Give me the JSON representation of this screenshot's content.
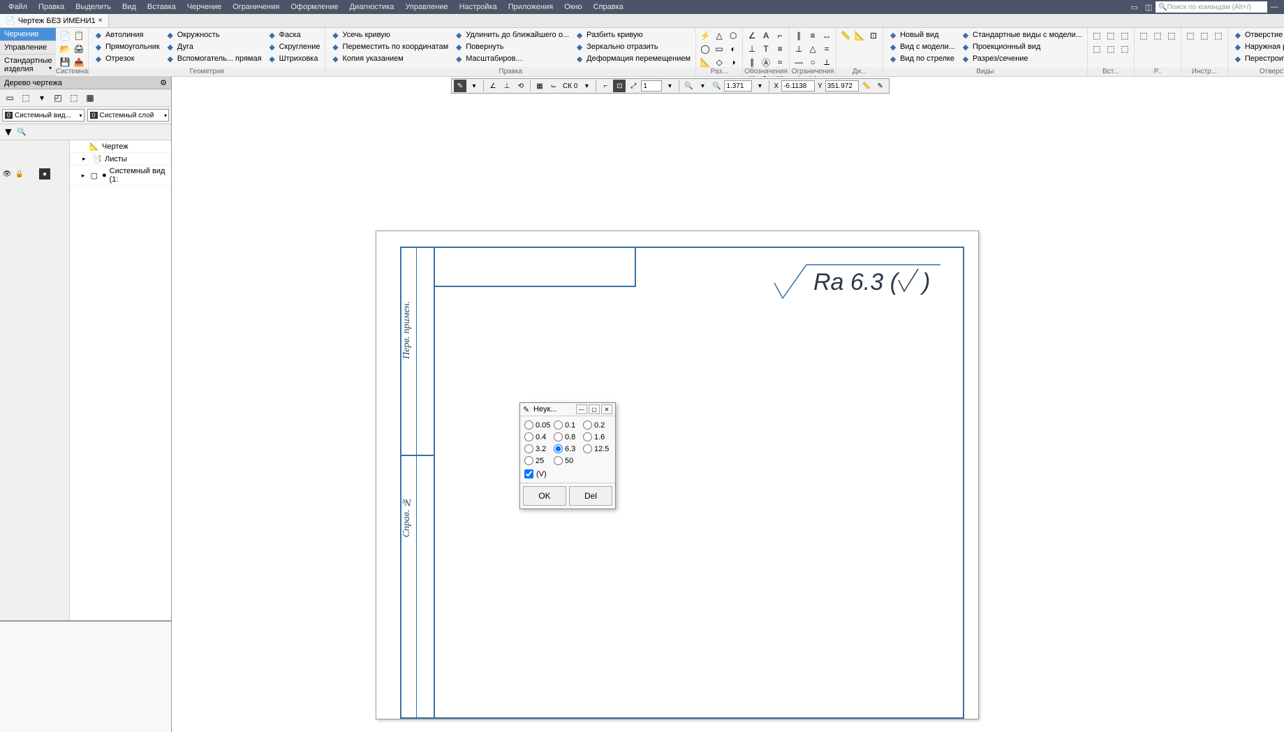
{
  "menubar": {
    "items": [
      "Файл",
      "Правка",
      "Выделить",
      "Вид",
      "Вставка",
      "Черчение",
      "Ограничения",
      "Оформление",
      "Диагностика",
      "Управление",
      "Настройка",
      "Приложения",
      "Окно",
      "Справка"
    ],
    "search_placeholder": "Поиск по командам (Alt+/)"
  },
  "doc_tab": {
    "title": "Чертеж БЕЗ ИМЕНИ1"
  },
  "ribbon_tabs": {
    "active": "Черчение",
    "others": [
      "Управление",
      "Стандартные изделия"
    ]
  },
  "ribbon": {
    "groups": [
      {
        "label": "Системная",
        "type": "icons"
      },
      {
        "label": "Геометрия",
        "cols": [
          [
            "Автолиния",
            "Прямоугольник",
            "Отрезок"
          ],
          [
            "Окружность",
            "Дуга",
            "Вспомогатель... прямая"
          ],
          [
            "Фаска",
            "Скругление",
            "Штриховка"
          ]
        ]
      },
      {
        "label": "Правка",
        "cols": [
          [
            "Усечь кривую",
            "Переместить по координатам",
            "Копия указанием"
          ],
          [
            "Удлинить до ближайшего о...",
            "Повернуть",
            "Масштабиров..."
          ],
          [
            "Разбить кривую",
            "Зеркально отразить",
            "Деформация перемещением"
          ]
        ]
      },
      {
        "label": "Раз...",
        "type": "icon-grid"
      },
      {
        "label": "Обозначения",
        "type": "icon-grid"
      },
      {
        "label": "Ограничения",
        "type": "icon-grid"
      },
      {
        "label": "Ди...",
        "type": "icon-grid"
      },
      {
        "label": "Виды",
        "cols": [
          [
            "Новый вид",
            "Вид с модели...",
            "Вид по стрелке"
          ],
          [
            "Стандартные виды с модели...",
            "Проекционный вид",
            "Разрез/сечение"
          ]
        ]
      },
      {
        "label": "Вст...",
        "type": "icon-grid"
      },
      {
        "label": "Р..",
        "type": "icon-grid"
      },
      {
        "label": "Инстр...",
        "type": "icon-grid"
      },
      {
        "label": "Отверстия и резьбы",
        "cols": [
          [
            "Отверстие простое",
            "Наружная резьба",
            "Перестроить отверстия и из..."
          ]
        ]
      }
    ]
  },
  "tree_panel": {
    "title": "Дерево чертежа",
    "dd1": "Системный вид...",
    "dd2": "Системный слой",
    "nodes": {
      "root": "Чертеж",
      "sheets": "Листы",
      "sysview": "Системный вид (1:"
    }
  },
  "canvas_toolbar": {
    "cs": "СК 0",
    "step": "1",
    "zoom": "1.371",
    "x_label": "X",
    "x": "-6.1138",
    "y_label": "Y",
    "y": "351.972"
  },
  "roughness_text": "Ra 6.3 ( √ )",
  "sheet_labels": {
    "perv": "Перв. примен.",
    "sprav": "Справ. №"
  },
  "dialog": {
    "title": "Неук...",
    "options": [
      "0.05",
      "0.1",
      "0.2",
      "0.4",
      "0.8",
      "1.6",
      "3.2",
      "6.3",
      "12.5",
      "25",
      "50"
    ],
    "selected": "6.3",
    "check_label": "(V)",
    "checked": true,
    "ok": "OK",
    "del": "Del"
  }
}
